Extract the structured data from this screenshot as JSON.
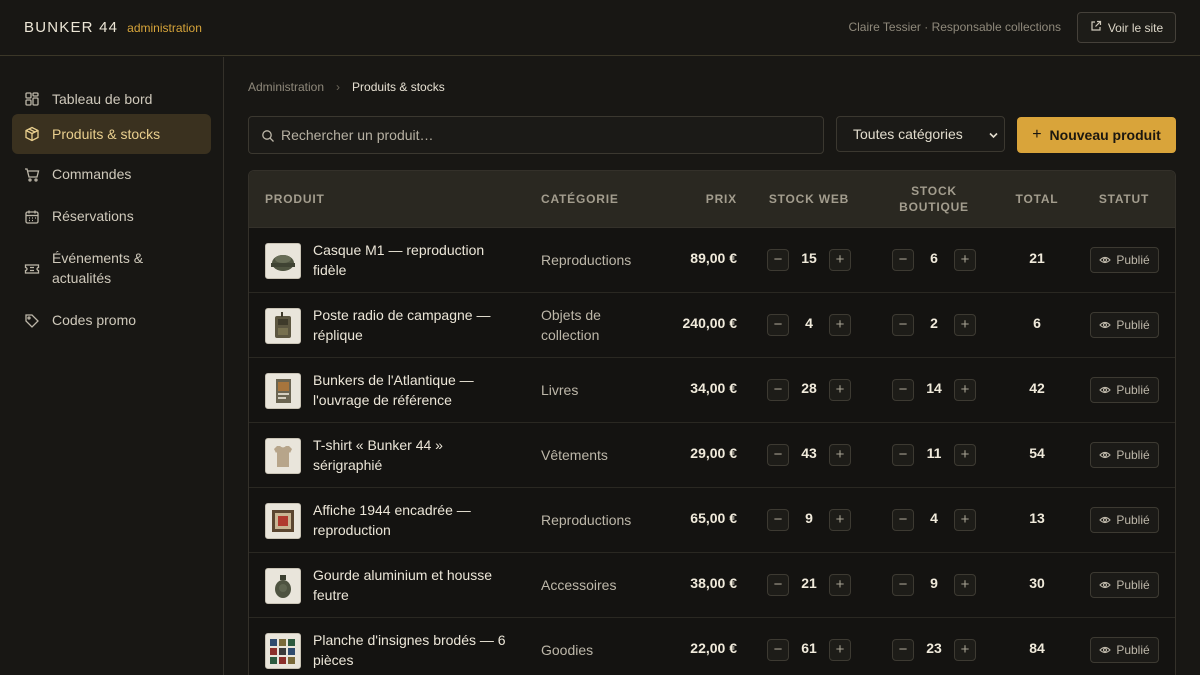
{
  "header": {
    "brand": "BUNKER 44",
    "subtitle": "administration",
    "user": "Claire Tessier · Responsable collections",
    "view_site": "Voir le site"
  },
  "sidebar": {
    "items": [
      {
        "label": "Tableau de bord",
        "icon": "dashboard-icon",
        "active": false
      },
      {
        "label": "Produits & stocks",
        "icon": "box-icon",
        "active": true
      },
      {
        "label": "Commandes",
        "icon": "cart-icon",
        "active": false
      },
      {
        "label": "Réservations",
        "icon": "calendar-icon",
        "active": false
      },
      {
        "label": "Événements & actualités",
        "icon": "ticket-icon",
        "active": false
      },
      {
        "label": "Codes promo",
        "icon": "tag-icon",
        "active": false
      }
    ]
  },
  "breadcrumb": {
    "root": "Administration",
    "separator": "›",
    "current": "Produits & stocks"
  },
  "toolbar": {
    "search_placeholder": "Rechercher un produit…",
    "category_selected": "Toutes catégories",
    "new_product": "Nouveau produit"
  },
  "table": {
    "headers": {
      "product": "PRODUIT",
      "category": "CATÉGORIE",
      "price": "PRIX",
      "stock_web": "STOCK WEB",
      "stock_shop": "STOCK BOUTIQUE",
      "total": "TOTAL",
      "status": "STATUT"
    },
    "rows": [
      {
        "name": "Casque M1 — reproduction fidèle",
        "category": "Reproductions",
        "price": "89,00 €",
        "stock_web": "15",
        "stock_shop": "6",
        "total": "21",
        "status": "Publié",
        "thumb": "helmet"
      },
      {
        "name": "Poste radio de campagne — réplique",
        "category": "Objets de collection",
        "price": "240,00 €",
        "stock_web": "4",
        "stock_shop": "2",
        "total": "6",
        "status": "Publié",
        "thumb": "radio"
      },
      {
        "name": "Bunkers de l'Atlantique — l'ouvrage de référence",
        "category": "Livres",
        "price": "34,00 €",
        "stock_web": "28",
        "stock_shop": "14",
        "total": "42",
        "status": "Publié",
        "thumb": "book"
      },
      {
        "name": "T-shirt « Bunker 44 » sérigraphié",
        "category": "Vêtements",
        "price": "29,00 €",
        "stock_web": "43",
        "stock_shop": "11",
        "total": "54",
        "status": "Publié",
        "thumb": "shirt"
      },
      {
        "name": "Affiche 1944 encadrée — reproduction",
        "category": "Reproductions",
        "price": "65,00 €",
        "stock_web": "9",
        "stock_shop": "4",
        "total": "13",
        "status": "Publié",
        "thumb": "poster"
      },
      {
        "name": "Gourde aluminium et housse feutre",
        "category": "Accessoires",
        "price": "38,00 €",
        "stock_web": "21",
        "stock_shop": "9",
        "total": "30",
        "status": "Publié",
        "thumb": "canteen"
      },
      {
        "name": "Planche d'insignes brodés — 6 pièces",
        "category": "Goodies",
        "price": "22,00 €",
        "stock_web": "61",
        "stock_shop": "23",
        "total": "84",
        "status": "Publié",
        "thumb": "patches"
      }
    ]
  },
  "colors": {
    "accent": "#d9a43a",
    "background": "#181714",
    "active_nav_bg": "#3a311f"
  }
}
